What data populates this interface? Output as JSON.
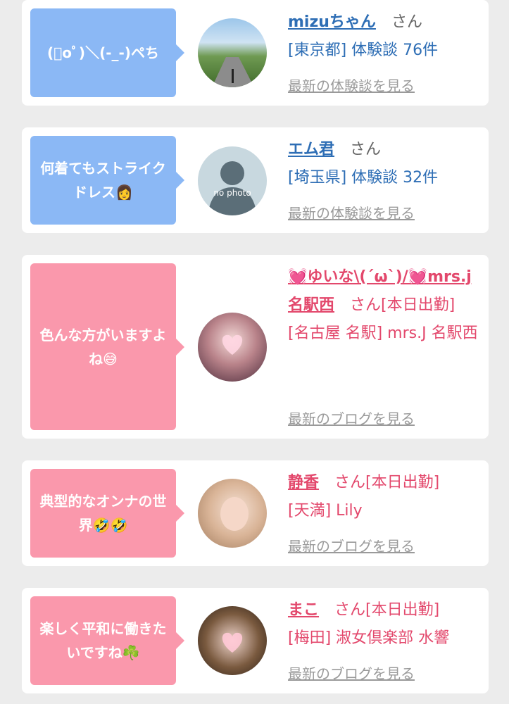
{
  "cards": [
    {
      "bubble": "(ﾟoﾟ)＼(-_-)ペち",
      "name": "mizuちゃん",
      "san": "さん",
      "meta": "[東京都] 体験談 76件",
      "more": "最新の体験談を見る"
    },
    {
      "bubble": "何着てもストライクドレス👩",
      "name": "エム君",
      "san": "さん",
      "meta": "[埼玉県] 体験談 32件",
      "more": "最新の体験談を見る",
      "photo_text": "no photo"
    },
    {
      "bubble": "色んな方がいますよね😅",
      "name": "💓ゆいな\\(´ω`)/💓mrs.j名駅西",
      "san": "さん[本日出勤]",
      "meta": "[名古屋 名駅] mrs.J 名駅西",
      "more": "最新のブログを見る"
    },
    {
      "bubble": "典型的なオンナの世界🤣🤣",
      "name": "静香",
      "san": "さん[本日出勤]",
      "meta": "[天満] Lily",
      "more": "最新のブログを見る"
    },
    {
      "bubble": "楽しく平和に働きたいですね☘️",
      "name": "まこ",
      "san": "さん[本日出勤]",
      "meta": "[梅田] 淑女倶楽部 水響",
      "more": "最新のブログを見る"
    }
  ],
  "colors": {
    "blue_bubble": "#8bb8f5",
    "pink_bubble": "#fa98ac",
    "blue_text": "#2e6eb5",
    "pink_text": "#e3486c"
  }
}
